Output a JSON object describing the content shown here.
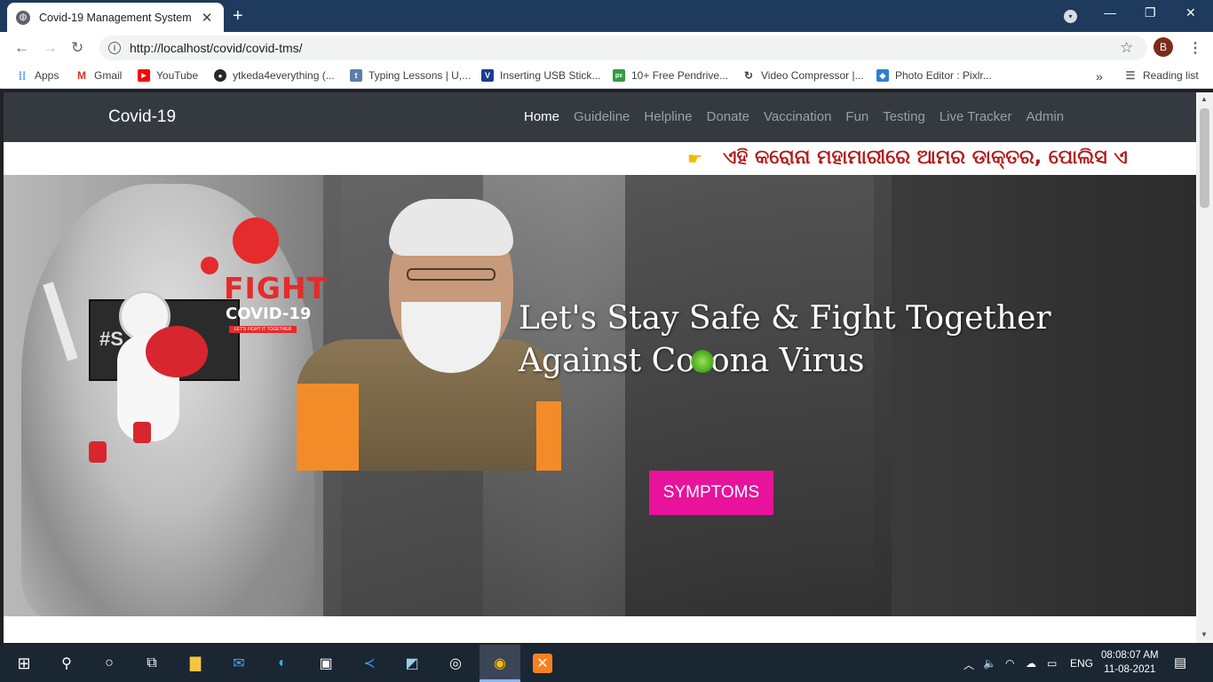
{
  "browser": {
    "tab_title": "Covid-19 Management System",
    "url": "http://localhost/covid/covid-tms/",
    "profile_initial": "B",
    "bookmarks_overflow": "»",
    "reading_list": "Reading list",
    "bookmarks": [
      {
        "label": "Apps",
        "icon": "apps-grid-icon"
      },
      {
        "label": "Gmail",
        "icon": "gmail-icon"
      },
      {
        "label": "YouTube",
        "icon": "youtube-icon"
      },
      {
        "label": "ytkeda4everything (...",
        "icon": "github-icon"
      },
      {
        "label": "Typing Lessons | U,...",
        "icon": "typing-icon"
      },
      {
        "label": "Inserting USB Stick...",
        "icon": "v-icon"
      },
      {
        "label": "10+ Free Pendrive...",
        "icon": "px-icon"
      },
      {
        "label": "Video Compressor |...",
        "icon": "compressor-icon"
      },
      {
        "label": "Photo Editor : Pixlr...",
        "icon": "pixlr-icon"
      }
    ]
  },
  "site": {
    "brand": "Covid-19",
    "nav": [
      "Home",
      "Guideline",
      "Helpline",
      "Donate",
      "Vaccination",
      "Fun",
      "Testing",
      "Live Tracker",
      "Admin"
    ],
    "active_nav": "Home",
    "marquee_text": "ଏହି କରୋନା ମହାମାରୀରେ ଆମର ଡାକ୍ତର, ପୋଲିସ ଏ",
    "hero": {
      "poster_fight": "FIGHT",
      "poster_covid": "COVID-19",
      "poster_tagline": "LET'S FIGHT IT TOGETHER",
      "sign_text": "#S",
      "title_line1": "Let's Stay Safe & Fight Together",
      "title_line2": "Against Corona Virus",
      "button_label": "SYMPTOMS"
    }
  },
  "taskbar": {
    "language": "ENG",
    "time": "08:08:07 AM",
    "date": "11-08-2021"
  },
  "colors": {
    "accent_button": "#e8129b",
    "navbar": "#343a40",
    "tabstrip": "#1e3a5c",
    "marquee_text": "#b31b1b"
  }
}
